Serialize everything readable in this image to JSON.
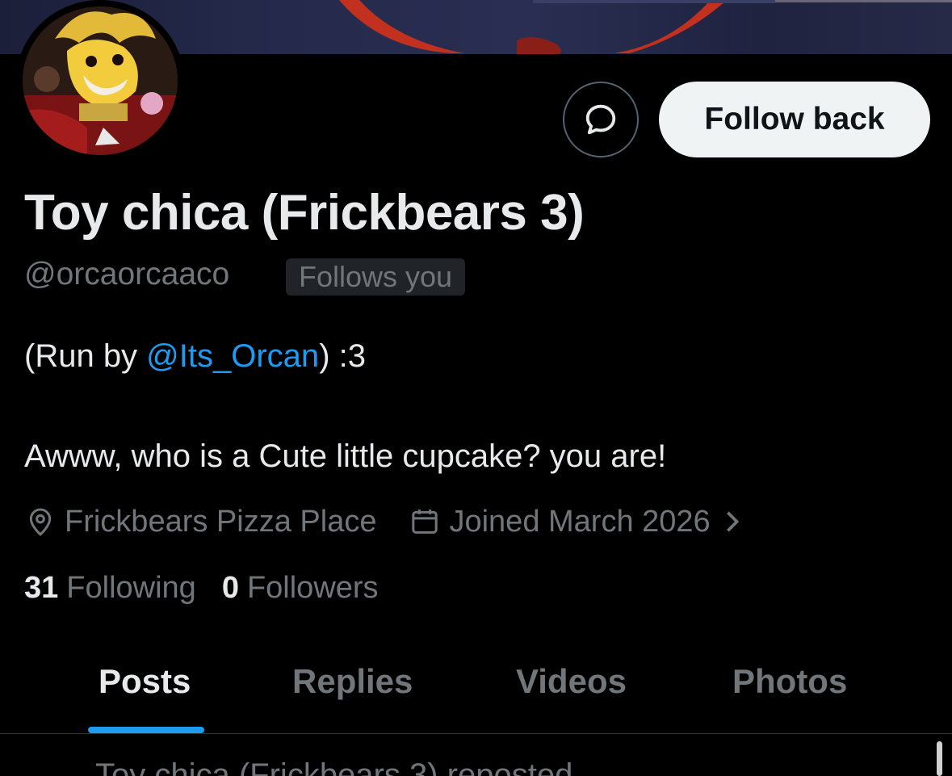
{
  "profile": {
    "display_name": "Toy chica (Frickbears 3)",
    "handle": "@orcaorcaaco",
    "follows_you_badge": "Follows you",
    "bio": {
      "prefix": "(Run by ",
      "mention": "@Its_Orcan",
      "suffix": ") :3",
      "line2": "Awww, who is a Cute little cupcake? you are!"
    },
    "location": "Frickbears Pizza Place",
    "joined": "Joined March 2026",
    "following_count": "31",
    "following_label": "Following",
    "followers_count": "0",
    "followers_label": "Followers"
  },
  "actions": {
    "follow_back_label": "Follow back",
    "message_icon": "message-bubble-icon"
  },
  "tabs": [
    {
      "label": "Posts",
      "active": true
    },
    {
      "label": "Replies",
      "active": false
    },
    {
      "label": "Videos",
      "active": false
    },
    {
      "label": "Photos",
      "active": false
    }
  ],
  "peek_post": {
    "text": "Toy chica (Frickbears 3) reposted"
  },
  "colors": {
    "background": "#000000",
    "accent": "#1d9bf0",
    "text_primary": "#e7e9ea",
    "text_secondary": "#71767b",
    "follow_button_bg": "#eff3f4"
  }
}
